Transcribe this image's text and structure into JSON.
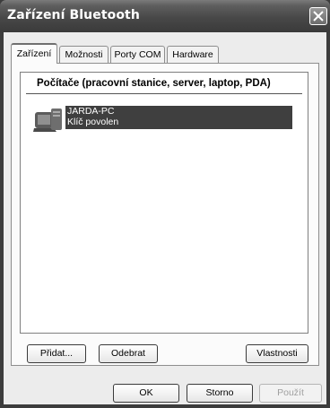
{
  "window": {
    "title": "Zařízení Bluetooth"
  },
  "tabs": [
    {
      "label": "Zařízení",
      "active": true
    },
    {
      "label": "Možnosti",
      "active": false
    },
    {
      "label": "Porty COM",
      "active": false
    },
    {
      "label": "Hardware",
      "active": false
    }
  ],
  "list": {
    "header": "Počítače (pracovní stanice, server, laptop, PDA)",
    "devices": [
      {
        "name": "JARDA-PC",
        "status": "Klíč povolen",
        "icon": "computer-icon",
        "selected": true
      }
    ]
  },
  "buttons": {
    "add": "Přidat...",
    "remove": "Odebrat",
    "properties": "Vlastnosti",
    "ok": "OK",
    "cancel": "Storno",
    "apply": "Použít"
  },
  "colors": {
    "titlebar": "#484848",
    "selection": "#3f3f3f",
    "dialog": "#ececec"
  }
}
